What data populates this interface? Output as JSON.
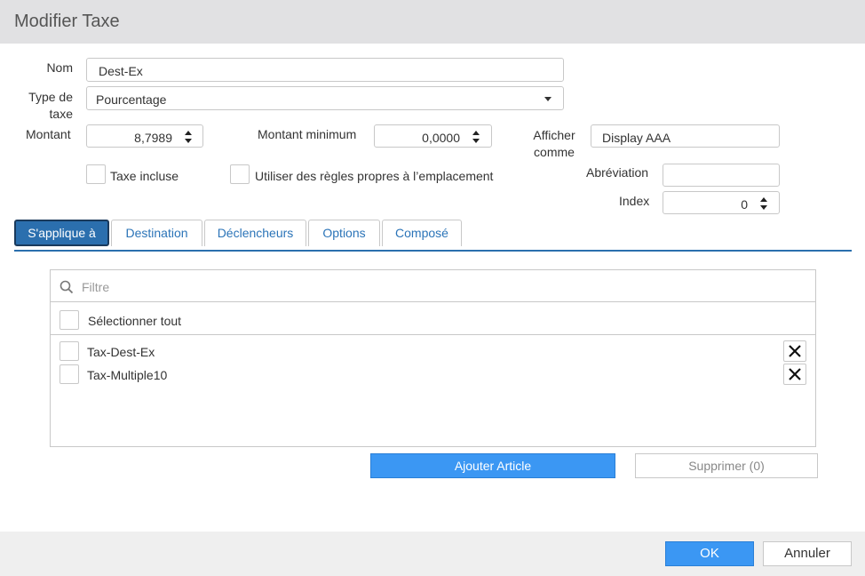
{
  "dialog": {
    "title": "Modifier Taxe"
  },
  "form": {
    "nom_label": "Nom",
    "nom_value": "Dest-Ex",
    "type_label_1": "Type de",
    "type_label_2": "taxe",
    "type_value": "Pourcentage",
    "montant_label": "Montant",
    "montant_value": "8,7989",
    "montant_min_label": "Montant minimum",
    "montant_min_value": "0,0000",
    "afficher_label_1": "Afficher",
    "afficher_label_2": "comme",
    "afficher_value": "Display AAA",
    "taxe_incluse_label": "Taxe incluse",
    "regles_label": "Utiliser des règles propres à l’emplacement",
    "abreviation_label": "Abréviation",
    "abreviation_value": "",
    "index_label": "Index",
    "index_value": "0"
  },
  "tabs": [
    {
      "label": "S'applique à",
      "active": true
    },
    {
      "label": "Destination",
      "active": false
    },
    {
      "label": "Déclencheurs",
      "active": false
    },
    {
      "label": "Options",
      "active": false
    },
    {
      "label": "Composé",
      "active": false
    }
  ],
  "applies_to": {
    "filter_placeholder": "Filtre",
    "select_all_label": "Sélectionner tout",
    "items": [
      {
        "label": "Tax-Dest-Ex"
      },
      {
        "label": "Tax-Multiple10"
      }
    ],
    "add_button": "Ajouter Article",
    "delete_button": "Supprimer (0)"
  },
  "footer": {
    "ok_label": "OK",
    "cancel_label": "Annuler"
  },
  "colors": {
    "accent": "#3b97f3",
    "tab_active": "#2b6fae",
    "header_bg": "#e1e1e3",
    "footer_bg": "#efefef"
  }
}
